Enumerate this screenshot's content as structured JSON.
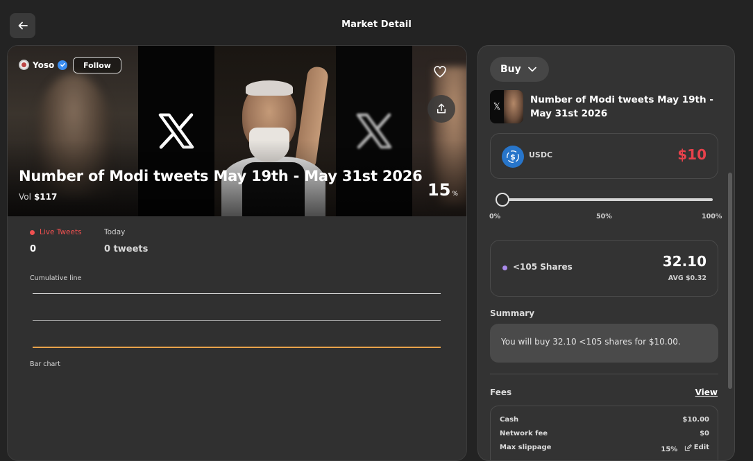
{
  "header": {
    "title": "Market Detail"
  },
  "market": {
    "creator": "Yoso",
    "follow_label": "Follow",
    "title": "Number of Modi tweets May 19th - May 31st 2026",
    "vol_label": "Vol",
    "vol_value": "$117",
    "percent": "15",
    "percent_unit": "%"
  },
  "stats": {
    "live_label": "Live Tweets",
    "live_count": "0",
    "today_label": "Today",
    "today_count": "0 tweets",
    "cumulative_label": "Cumulative line",
    "bar_label": "Bar chart"
  },
  "trade": {
    "mode": "Buy",
    "market_title": "Number of Modi tweets May 19th - May 31st 2026",
    "currency": "USDC",
    "amount": "$10",
    "slider_fraction": 0,
    "ticks": [
      "0%",
      "50%",
      "100%"
    ],
    "shares_label": "<105 Shares",
    "shares_value": "32.10",
    "shares_avg": "AVG $0.32",
    "summary_title": "Summary",
    "summary_text": "You will buy 32.10 <105 shares for $10.00.",
    "fees_title": "Fees",
    "fees_view": "View",
    "fees": [
      {
        "label": "Cash",
        "value": "$10.00"
      },
      {
        "label": "Network fee",
        "value": "$0"
      },
      {
        "label": "Max slippage",
        "value": "15%"
      }
    ],
    "edit_label": "Edit"
  },
  "colors": {
    "accent_red": "#e8414b",
    "live_red": "#ef5050",
    "shares_purple": "#a98aeb",
    "usdc_blue": "#2775ca",
    "cumulative_orange": "#e8a24a"
  },
  "icons": [
    "arrow-left-icon",
    "verified-icon",
    "heart-icon",
    "share-icon",
    "chevron-down-icon",
    "usdc-icon",
    "x-logo-icon",
    "edit-icon"
  ]
}
